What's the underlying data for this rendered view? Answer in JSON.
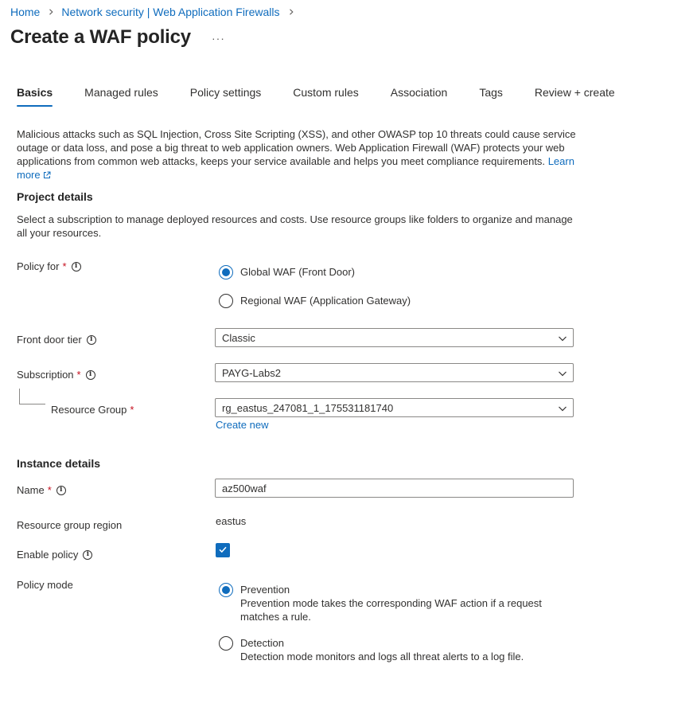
{
  "breadcrumb": {
    "home": "Home",
    "parent": "Network security | Web Application Firewalls"
  },
  "page": {
    "title": "Create a WAF policy",
    "more": "···"
  },
  "tabs": [
    "Basics",
    "Managed rules",
    "Policy settings",
    "Custom rules",
    "Association",
    "Tags",
    "Review + create"
  ],
  "intro": {
    "text": "Malicious attacks such as SQL Injection, Cross Site Scripting (XSS), and other OWASP top 10 threats could cause service outage or data loss, and pose a big threat to web application owners. Web Application Firewall (WAF) protects your web applications from common web attacks, keeps your service available and helps you meet compliance requirements.",
    "learn_more": "Learn more"
  },
  "project": {
    "heading": "Project details",
    "description": "Select a subscription to manage deployed resources and costs. Use resource groups like folders to organize and manage all your resources.",
    "policy_for_label": "Policy for",
    "policy_for_options": [
      "Global WAF (Front Door)",
      "Regional WAF (Application Gateway)"
    ],
    "front_door_tier_label": "Front door tier",
    "front_door_tier_value": "Classic",
    "subscription_label": "Subscription",
    "subscription_value": "PAYG-Labs2",
    "resource_group_label": "Resource Group",
    "resource_group_value": "rg_eastus_247081_1_175531181740",
    "create_new": "Create new"
  },
  "instance": {
    "heading": "Instance details",
    "name_label": "Name",
    "name_value": "az500waf",
    "region_label": "Resource group region",
    "region_value": "eastus",
    "enable_label": "Enable policy",
    "mode_label": "Policy mode",
    "modes": [
      {
        "label": "Prevention",
        "description": "Prevention mode takes the corresponding WAF action if a request matches a rule."
      },
      {
        "label": "Detection",
        "description": "Detection mode monitors and logs all threat alerts to a log file."
      }
    ]
  },
  "required_marker": "*",
  "info_glyph": "i",
  "colors": {
    "accent": "#0f6cbd",
    "required": "#c50f1f"
  }
}
